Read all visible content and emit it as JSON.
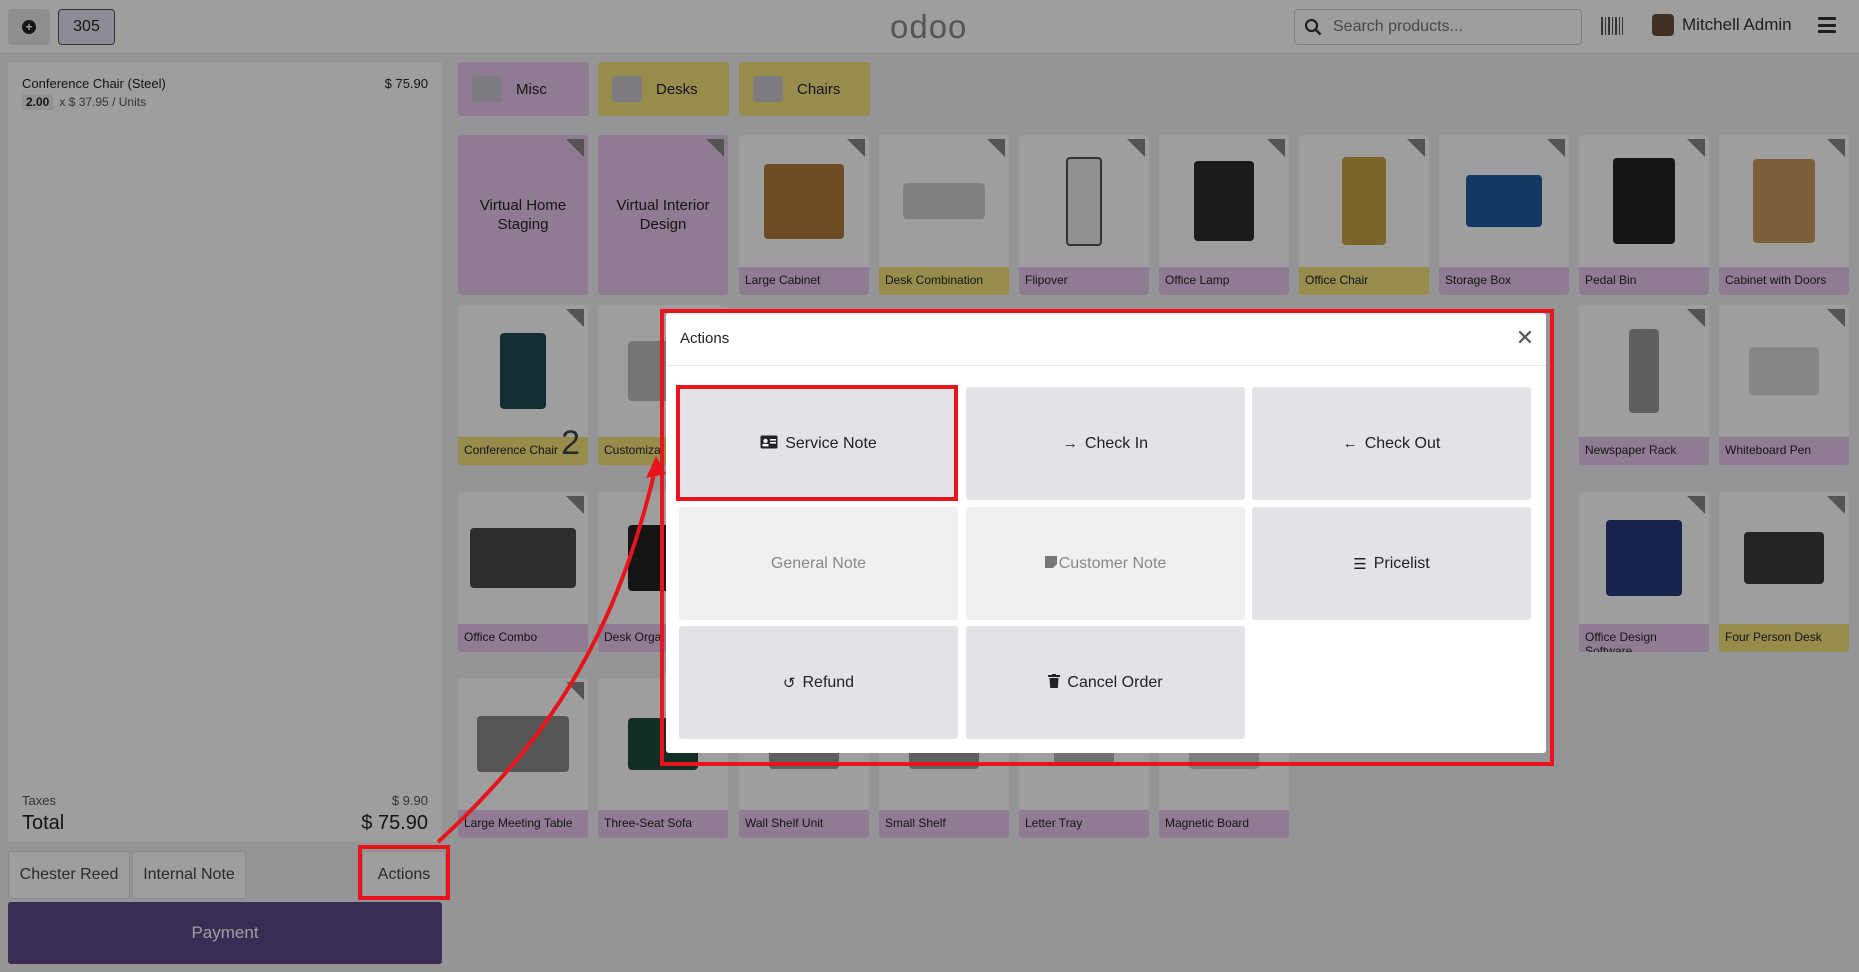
{
  "topbar": {
    "order_number": "305",
    "logo": "odoo",
    "search_placeholder": "Search products...",
    "user_name": "Mitchell Admin"
  },
  "order": {
    "lines": [
      {
        "name": "Conference Chair (Steel)",
        "price": "$ 75.90",
        "qty": "2.00",
        "unit_info": "x $ 37.95 / Units"
      }
    ],
    "taxes_label": "Taxes",
    "taxes_value": "$ 9.90",
    "total_label": "Total",
    "total_value": "$ 75.90"
  },
  "controls": {
    "customer": "Chester Reed",
    "internal_note": "Internal Note",
    "actions": "Actions",
    "payment": "Payment"
  },
  "categories": [
    {
      "label": "Misc",
      "color": "#e8c9ec"
    },
    {
      "label": "Desks",
      "color": "#f6e27c"
    },
    {
      "label": "Chairs",
      "color": "#f6e27c"
    }
  ],
  "products": [
    {
      "name": "Virtual Home Staging",
      "color": "pink",
      "virtual": true
    },
    {
      "name": "Virtual Interior Design",
      "color": "pink",
      "virtual": true
    },
    {
      "name": "Large Cabinet",
      "color": "pink"
    },
    {
      "name": "Desk Combination",
      "color": "yellow"
    },
    {
      "name": "Flipover",
      "color": "pink"
    },
    {
      "name": "Office Lamp",
      "color": "pink"
    },
    {
      "name": "Office Chair",
      "color": "yellow"
    },
    {
      "name": "Storage Box",
      "color": "pink"
    },
    {
      "name": "Pedal Bin",
      "color": "pink"
    },
    {
      "name": "Cabinet with Doors",
      "color": "pink"
    },
    {
      "name": "Conference Chair",
      "color": "yellow",
      "count": "2"
    },
    {
      "name": "Customiza",
      "color": "yellow"
    },
    {
      "name": "Newspaper Rack",
      "color": "pink"
    },
    {
      "name": "Whiteboard Pen",
      "color": "pink"
    },
    {
      "name": "Office Combo",
      "color": "pink"
    },
    {
      "name": "Desk Orga",
      "color": "pink"
    },
    {
      "name": "Office Design Software",
      "color": "pink"
    },
    {
      "name": "Four Person Desk",
      "color": "yellow"
    },
    {
      "name": "Large Meeting Table",
      "color": "pink"
    },
    {
      "name": "Three-Seat Sofa",
      "color": "pink"
    },
    {
      "name": "Wall Shelf Unit",
      "color": "pink"
    },
    {
      "name": "Small Shelf",
      "color": "pink"
    },
    {
      "name": "Letter Tray",
      "color": "pink"
    },
    {
      "name": "Magnetic Board",
      "color": "pink"
    }
  ],
  "modal": {
    "title": "Actions",
    "buttons": [
      {
        "label": "Service Note",
        "icon": "id-card-icon"
      },
      {
        "label": "Check In",
        "icon": "arrow-right-icon"
      },
      {
        "label": "Check Out",
        "icon": "arrow-left-icon"
      },
      {
        "label": "General Note",
        "icon": "",
        "disabled": true
      },
      {
        "label": "Customer Note",
        "icon": "note-icon",
        "disabled": true
      },
      {
        "label": "Pricelist",
        "icon": "list-icon"
      },
      {
        "label": "Refund",
        "icon": "undo-icon"
      },
      {
        "label": "Cancel Order",
        "icon": "trash-icon"
      }
    ]
  },
  "annotation_color": "#e8141c"
}
